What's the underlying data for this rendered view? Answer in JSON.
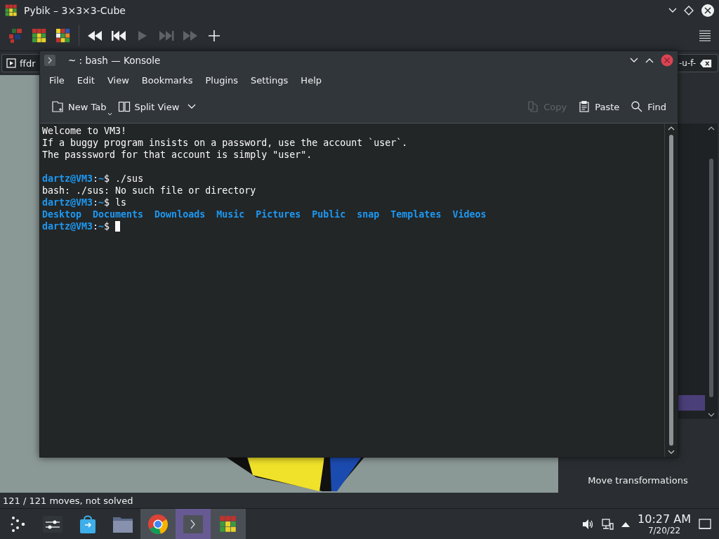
{
  "pybik": {
    "title": "Pybik – 3×3×3-Cube",
    "view_buttons": [
      {
        "kind": "cube-flat"
      },
      {
        "kind": "cube-solved"
      },
      {
        "kind": "cube-scrambled"
      }
    ],
    "playback": [
      {
        "kind": "rewind",
        "disabled": false
      },
      {
        "kind": "previous",
        "disabled": false
      },
      {
        "kind": "play",
        "disabled": true
      },
      {
        "kind": "next",
        "disabled": true
      },
      {
        "kind": "forward",
        "disabled": true
      },
      {
        "kind": "add",
        "disabled": false
      }
    ],
    "move_field": {
      "value_start": "ffdr",
      "value_end": "-u-f-"
    },
    "side_panel": {
      "button": "Move transformations"
    },
    "status": "121 / 121 moves, not solved"
  },
  "konsole": {
    "title": "~ : bash — Konsole",
    "menu": [
      "File",
      "Edit",
      "View",
      "Bookmarks",
      "Plugins",
      "Settings",
      "Help"
    ],
    "toolbar": [
      {
        "kind": "new-tab",
        "label": "New Tab",
        "disabled": false
      },
      {
        "kind": "split-view",
        "label": "Split View",
        "disabled": false
      },
      {
        "kind": "copy",
        "label": "Copy",
        "disabled": true
      },
      {
        "kind": "paste",
        "label": "Paste",
        "disabled": false
      },
      {
        "kind": "find",
        "label": "Find",
        "disabled": false
      }
    ],
    "terminal": [
      {
        "kind": "text",
        "segments": [
          {
            "kind": "plain",
            "text": "Welcome to VM3!"
          }
        ]
      },
      {
        "kind": "text",
        "segments": [
          {
            "kind": "plain",
            "text": "If a buggy program insists on a password, use the account `user`."
          }
        ]
      },
      {
        "kind": "text",
        "segments": [
          {
            "kind": "plain",
            "text": "The passsword for that account is simply \"user\"."
          }
        ]
      },
      {
        "kind": "blank"
      },
      {
        "kind": "text",
        "segments": [
          {
            "kind": "user",
            "text": "dartz@VM3"
          },
          {
            "kind": "plain",
            "text": ":"
          },
          {
            "kind": "path",
            "text": "~"
          },
          {
            "kind": "plain",
            "text": "$ ./sus"
          }
        ]
      },
      {
        "kind": "text",
        "segments": [
          {
            "kind": "plain",
            "text": "bash: ./sus: No such file or directory"
          }
        ]
      },
      {
        "kind": "text",
        "segments": [
          {
            "kind": "user",
            "text": "dartz@VM3"
          },
          {
            "kind": "plain",
            "text": ":"
          },
          {
            "kind": "path",
            "text": "~"
          },
          {
            "kind": "plain",
            "text": "$ ls"
          }
        ]
      },
      {
        "kind": "text",
        "segments": [
          {
            "kind": "dir",
            "text": "Desktop  Documents  Downloads  Music  Pictures  Public  snap  Templates  Videos"
          }
        ]
      },
      {
        "kind": "text",
        "segments": [
          {
            "kind": "user",
            "text": "dartz@VM3"
          },
          {
            "kind": "plain",
            "text": ":"
          },
          {
            "kind": "path",
            "text": "~"
          },
          {
            "kind": "plain",
            "text": "$ "
          },
          {
            "kind": "cursor"
          }
        ]
      }
    ]
  },
  "taskbar": {
    "tasks": [
      {
        "kind": "launcher",
        "open": false,
        "selected": false
      },
      {
        "kind": "settings",
        "open": false,
        "selected": false
      },
      {
        "kind": "store",
        "open": false,
        "selected": false
      },
      {
        "kind": "files",
        "open": false,
        "selected": false
      },
      {
        "kind": "browser",
        "open": true,
        "selected": false
      },
      {
        "kind": "terminal",
        "open": true,
        "selected": true
      },
      {
        "kind": "cube",
        "open": true,
        "selected": false
      }
    ],
    "clock": {
      "time": "10:27 AM",
      "date": "7/20/22"
    }
  }
}
